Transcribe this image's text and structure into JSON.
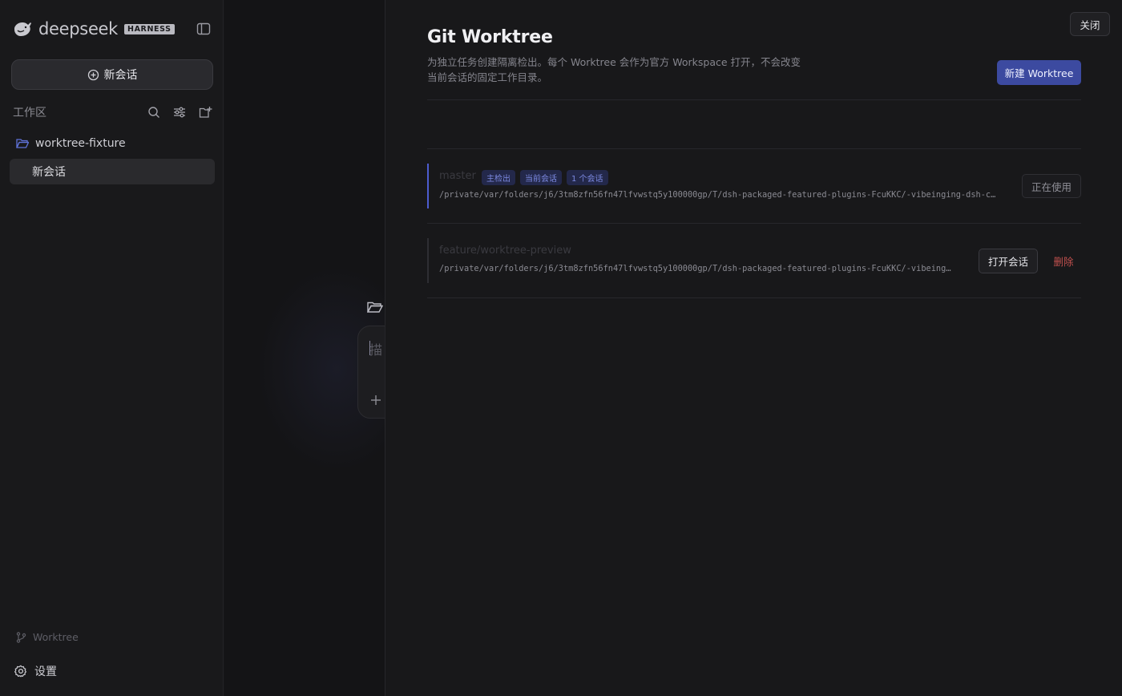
{
  "sidebar": {
    "brand_name": "deepseek",
    "brand_badge": "HARNESS",
    "new_chat_label": "新会话",
    "workspace_label": "工作区",
    "workspace_folder": "worktree-fixture",
    "chat_item": "新会话",
    "footer_worktree": "Worktree",
    "footer_settings": "设置"
  },
  "composer": {
    "placeholder": "描"
  },
  "panel": {
    "close_label": "关闭",
    "title": "Git Worktree",
    "description": "为独立任务创建隔离检出。每个 Worktree 会作为官方 Workspace 打开，不会改变当前会话的固定工作目录。",
    "new_worktree_label": "新建 Worktree",
    "worktrees": [
      {
        "branch": "master",
        "tags": [
          "主检出",
          "当前会话",
          "1 个会话"
        ],
        "path": "/private/var/folders/j6/3tm8zfn56fn47lfvwstq5y100000gp/T/dsh-packaged-featured-plugins-FcuKKC/-vibeinging-dsh-c…",
        "action_label": "正在使用"
      },
      {
        "branch": "feature/worktree-preview",
        "tags": [],
        "path": "/private/var/folders/j6/3tm8zfn56fn47lfvwstq5y100000gp/T/dsh-packaged-featured-plugins-FcuKKC/-vibeing…",
        "open_label": "打开会话",
        "delete_label": "删除"
      }
    ]
  },
  "colors": {
    "accent": "#3c4aa0",
    "active_bar": "#4c5ccf",
    "danger": "#c0504e",
    "tag_text": "#7c89e0"
  }
}
